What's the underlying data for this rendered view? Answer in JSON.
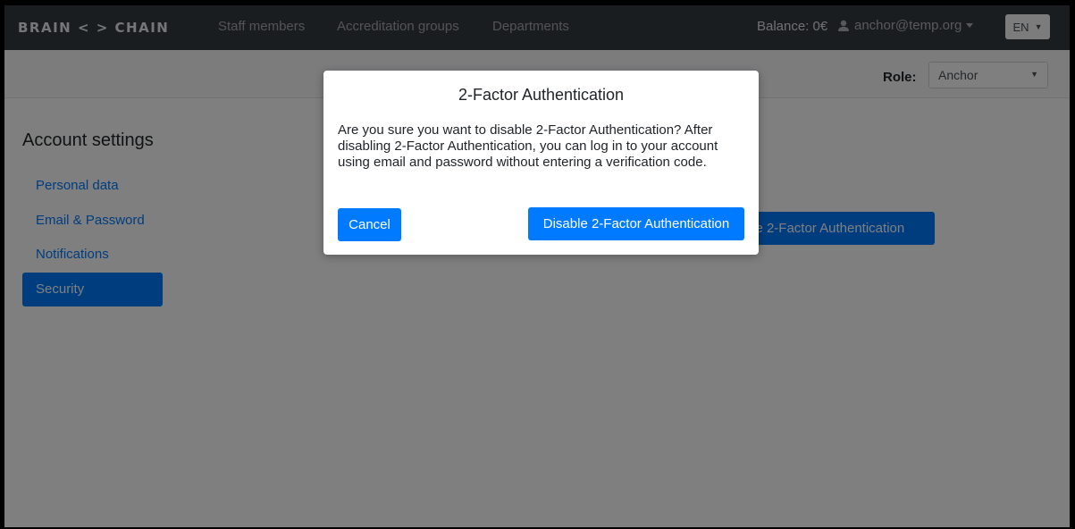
{
  "navbar": {
    "brand": "BRAIN < > CHAIN",
    "links": [
      "Staff members",
      "Accreditation groups",
      "Departments"
    ],
    "balance": "Balance: 0€",
    "user_email": "anchor@temp.org",
    "user_icon": "user-icon",
    "language": "EN"
  },
  "rolebar": {
    "label": "Role:",
    "selected": "Anchor"
  },
  "sidebar": {
    "title": "Account settings",
    "items": [
      {
        "label": "Personal data",
        "active": false
      },
      {
        "label": "Email & Password",
        "active": false
      },
      {
        "label": "Notifications",
        "active": false
      },
      {
        "label": "Security",
        "active": true
      }
    ]
  },
  "main": {
    "background_button_label": "Disable 2-Factor Authentication"
  },
  "modal": {
    "title": "2-Factor Authentication",
    "body": "Are you sure you want to disable 2-Factor Authentication? After disabling 2-Factor Authentication, you can log in to your account using email and password without entering a verification code.",
    "cancel_label": "Cancel",
    "confirm_label": "Disable 2-Factor Authentication"
  },
  "colors": {
    "navbar": "#343a40",
    "primary": "#007bff",
    "backdrop": "#000000"
  }
}
